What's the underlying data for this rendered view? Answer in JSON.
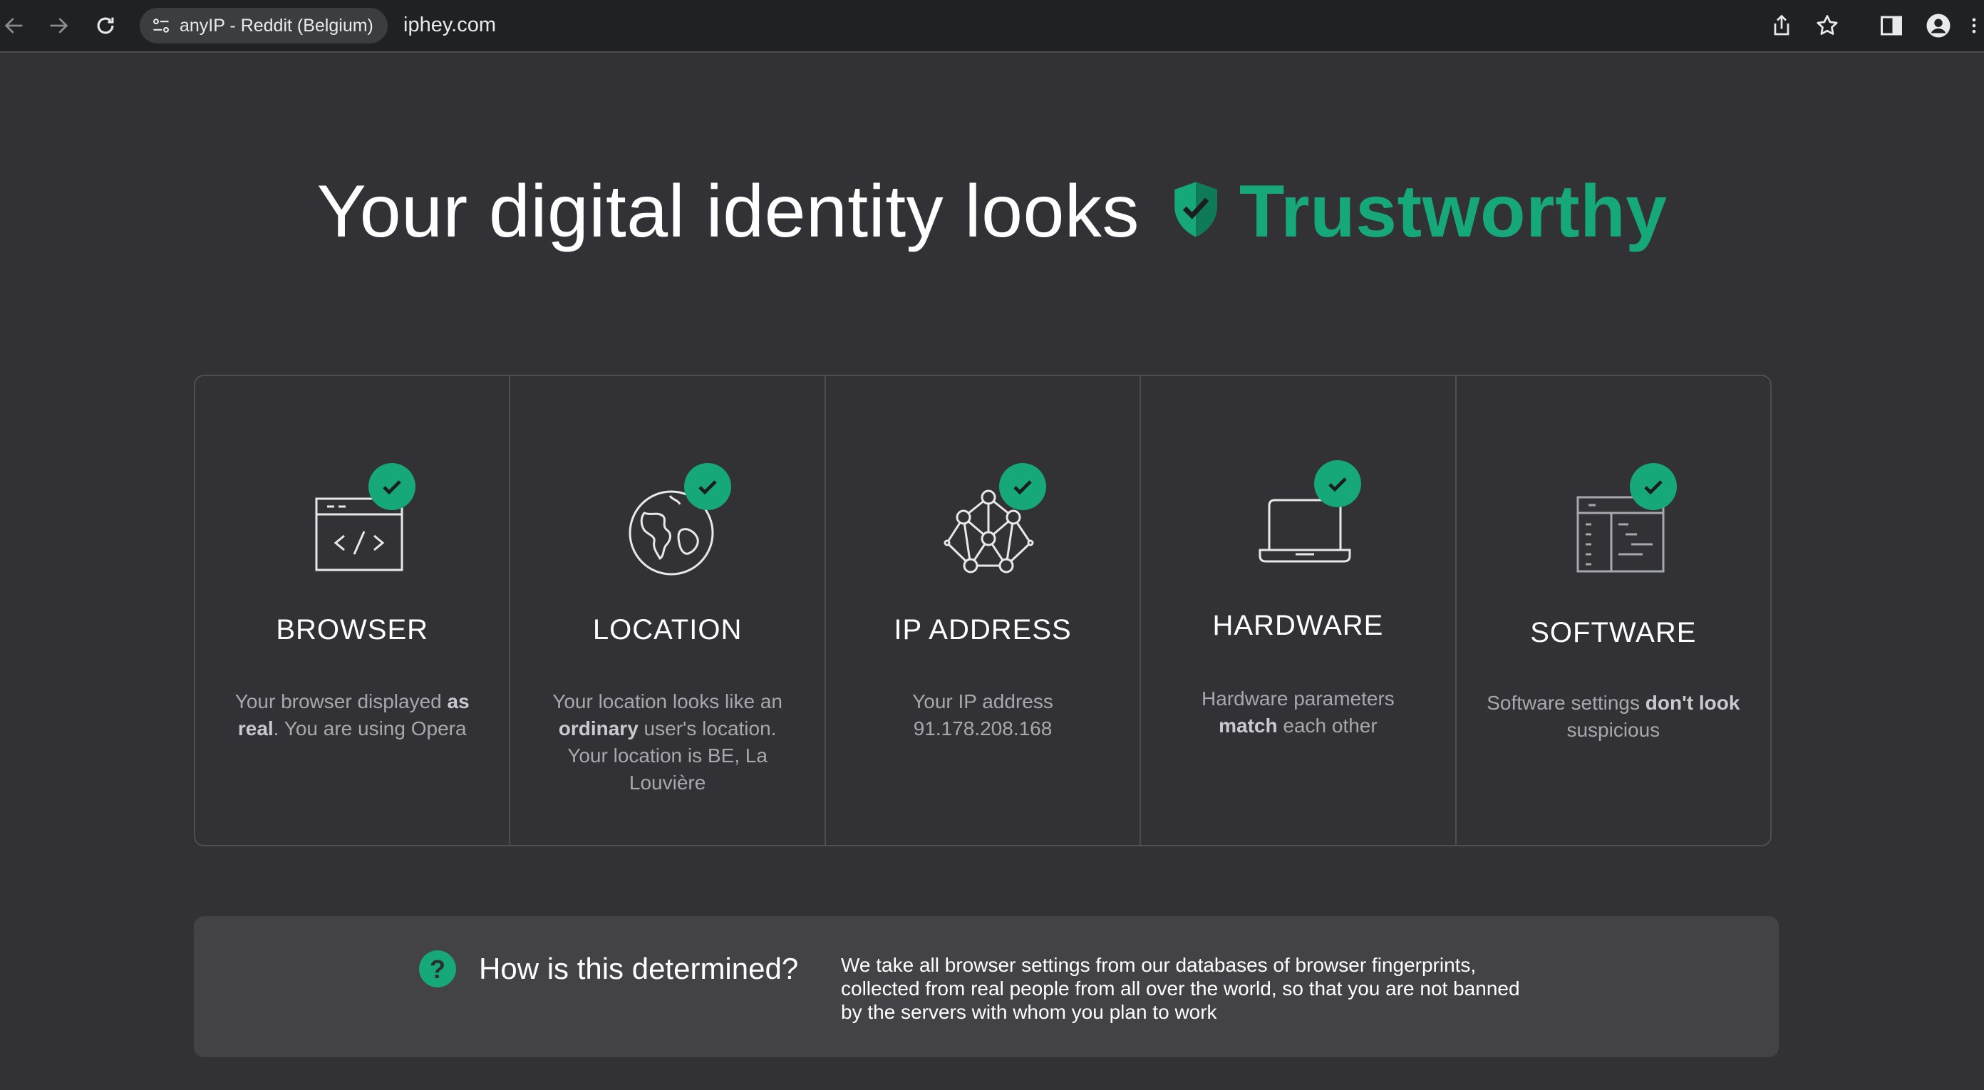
{
  "browser": {
    "site_chip_label": "anyIP - Reddit (Belgium)",
    "url": "iphey.com"
  },
  "headline": {
    "text": "Your digital identity looks",
    "verdict": "Trustworthy",
    "accent_color": "#16a878"
  },
  "cards": [
    {
      "title": "BROWSER",
      "icon": "browser-code-icon",
      "desc_parts": [
        "Your browser displayed ",
        "as real",
        ". You are using Opera"
      ]
    },
    {
      "title": "LOCATION",
      "icon": "globe-icon",
      "desc_parts": [
        "Your location looks like an ",
        "ordinary",
        " user's location. Your location is BE, La Louvière"
      ]
    },
    {
      "title": "IP ADDRESS",
      "icon": "network-icon",
      "desc_parts": [
        "Your IP address 91.178.208.168"
      ]
    },
    {
      "title": "HARDWARE",
      "icon": "laptop-icon",
      "desc_parts": [
        "Hardware parameters ",
        "match",
        " each other"
      ]
    },
    {
      "title": "SOFTWARE",
      "icon": "software-window-icon",
      "desc_parts": [
        "Software settings ",
        "don't look",
        " suspicious"
      ]
    }
  ],
  "info": {
    "icon_glyph": "?",
    "title": "How is this determined?",
    "text": "We take all browser settings from our databases of browser fingerprints, collected from real people from all over the world, so that you are not banned by the servers with whom you plan to work"
  }
}
